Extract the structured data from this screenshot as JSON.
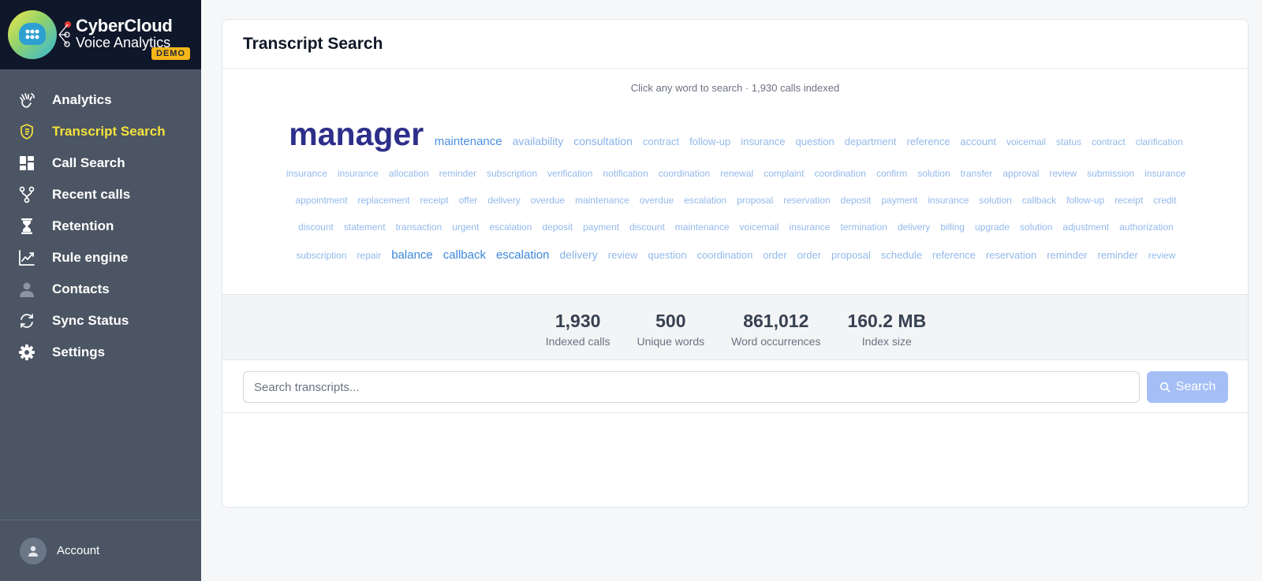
{
  "brand": {
    "name": "CyberCloud",
    "subtitle": "Voice Analytics",
    "badge": "DEMO"
  },
  "nav": [
    {
      "label": "Analytics",
      "icon": "hand-wave-icon",
      "active": false
    },
    {
      "label": "Transcript Search",
      "icon": "shield-icon",
      "active": true
    },
    {
      "label": "Call Search",
      "icon": "dashboard-grid-icon",
      "active": false
    },
    {
      "label": "Recent calls",
      "icon": "fork-icon",
      "active": false
    },
    {
      "label": "Retention",
      "icon": "hourglass-icon",
      "active": false
    },
    {
      "label": "Rule engine",
      "icon": "line-chart-icon",
      "active": false
    },
    {
      "label": "Contacts",
      "icon": "person-icon",
      "active": false
    },
    {
      "label": "Sync Status",
      "icon": "sync-icon",
      "active": false
    },
    {
      "label": "Settings",
      "icon": "gear-icon",
      "active": false
    }
  ],
  "account": {
    "label": "Account"
  },
  "card": {
    "title": "Transcript Search",
    "hint": "Click any word to search · 1,930 calls indexed"
  },
  "word_cloud": {
    "row1": [
      {
        "w": "manager",
        "s": "xxl"
      },
      {
        "w": "maintenance",
        "s": "l"
      },
      {
        "w": "availability",
        "s": "m"
      },
      {
        "w": "consultation",
        "s": "m"
      },
      {
        "w": "contract",
        "s": "s13"
      },
      {
        "w": "follow-up",
        "s": "s13"
      },
      {
        "w": "insurance",
        "s": "s13"
      },
      {
        "w": "question",
        "s": "s13"
      },
      {
        "w": "department",
        "s": "s13"
      },
      {
        "w": "reference",
        "s": "s13"
      },
      {
        "w": "account",
        "s": "s13"
      },
      {
        "w": "voicemail",
        "s": "s"
      },
      {
        "w": "status",
        "s": "s"
      },
      {
        "w": "contract",
        "s": "s"
      },
      {
        "w": "clarification",
        "s": "s"
      }
    ],
    "row2": [
      "insurance",
      "insurance",
      "allocation",
      "reminder",
      "subscription",
      "verification",
      "notification",
      "coordination",
      "renewal",
      "complaint",
      "coordination",
      "confirm",
      "solution",
      "transfer",
      "approval",
      "review",
      "submission",
      "insurance"
    ],
    "row3": [
      "appointment",
      "replacement",
      "receipt",
      "offer",
      "delivery",
      "overdue",
      "maintenance",
      "overdue",
      "escalation",
      "proposal",
      "reservation",
      "deposit",
      "payment",
      "insurance",
      "solution",
      "callback",
      "follow-up",
      "receipt",
      "credit"
    ],
    "row4": [
      "discount",
      "statement",
      "transaction",
      "urgent",
      "escalation",
      "deposit",
      "payment",
      "discount",
      "maintenance",
      "voicemail",
      "insurance",
      "termination",
      "delivery",
      "billing",
      "upgrade",
      "solution",
      "adjustment",
      "authorization"
    ],
    "row5": [
      {
        "w": "subscription",
        "s": "s"
      },
      {
        "w": "repair",
        "s": "s"
      },
      {
        "w": "balance",
        "s": "lb"
      },
      {
        "w": "callback",
        "s": "lb"
      },
      {
        "w": "escalation",
        "s": "lb"
      },
      {
        "w": "delivery",
        "s": "m"
      },
      {
        "w": "review",
        "s": "s13"
      },
      {
        "w": "question",
        "s": "s13"
      },
      {
        "w": "coordination",
        "s": "s13"
      },
      {
        "w": "order",
        "s": "s13"
      },
      {
        "w": "order",
        "s": "s13"
      },
      {
        "w": "proposal",
        "s": "s13"
      },
      {
        "w": "schedule",
        "s": "s13"
      },
      {
        "w": "reference",
        "s": "s13"
      },
      {
        "w": "reservation",
        "s": "s13"
      },
      {
        "w": "reminder",
        "s": "s13"
      },
      {
        "w": "reminder",
        "s": "s13"
      },
      {
        "w": "review",
        "s": "s"
      }
    ]
  },
  "stats": [
    {
      "value": "1,930",
      "label": "Indexed calls"
    },
    {
      "value": "500",
      "label": "Unique words"
    },
    {
      "value": "861,012",
      "label": "Word occurrences"
    },
    {
      "value": "160.2 MB",
      "label": "Index size"
    }
  ],
  "search": {
    "placeholder": "Search transcripts...",
    "value": "",
    "button_label": "Search"
  },
  "colors": {
    "sidebar": "#4b5563",
    "brand_bg": "#0f172a",
    "active": "#f5e23a",
    "accent": "#a5bff6",
    "demo_badge": "#f6b619"
  }
}
